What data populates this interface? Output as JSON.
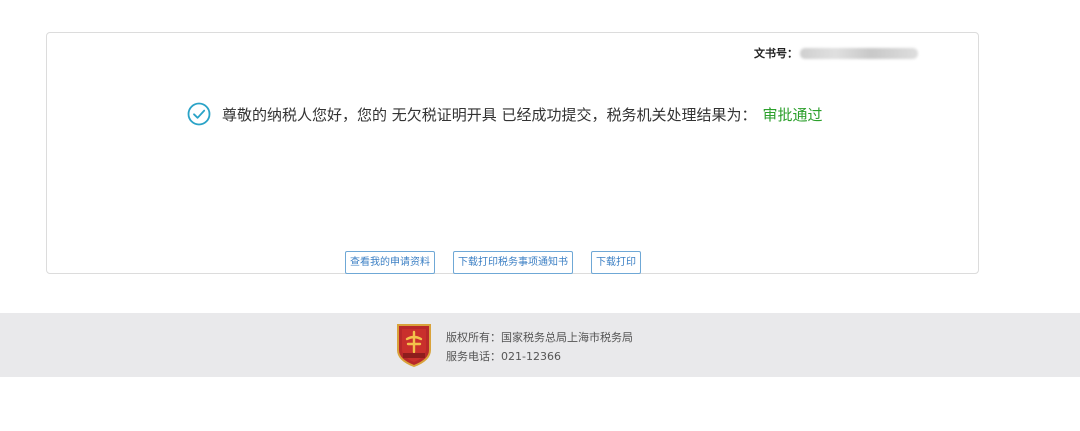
{
  "result": {
    "doc_number_label": "文书号：",
    "message_prefix": "尊敬的纳税人您好，您的 无欠税证明开具 已经成功提交，税务机关处理结果为：",
    "status_text": "审批通过",
    "status_color": "#2ca02c"
  },
  "buttons": {
    "view_application": "查看我的申请资料",
    "download_notice": "下载打印税务事项通知书",
    "download_print": "下载打印"
  },
  "footer": {
    "copyright": "版权所有：国家税务总局上海市税务局",
    "service_phone": "服务电话：021-12366"
  },
  "icons": {
    "success": "check-circle-icon",
    "logo": "tax-bureau-logo"
  }
}
